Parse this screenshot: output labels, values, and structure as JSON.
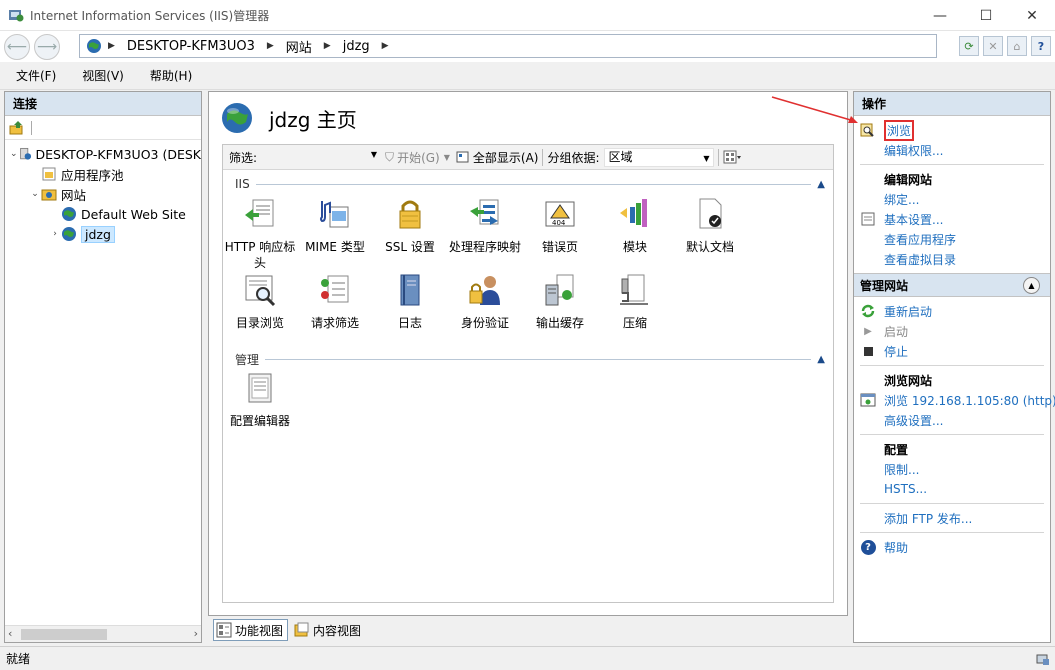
{
  "window": {
    "title": "Internet Information Services (IIS)管理器",
    "minimize_glyph": "—",
    "maximize_glyph": "☐",
    "close_glyph": "✕"
  },
  "address": {
    "segments": [
      "DESKTOP-KFM3UO3",
      "网站",
      "jdzg"
    ]
  },
  "menu": [
    "文件(F)",
    "视图(V)",
    "帮助(H)"
  ],
  "left_panel": {
    "header": "连接",
    "tree": [
      {
        "label": "DESKTOP-KFM3UO3 (DESK",
        "icon": "server-icon"
      },
      {
        "label": "应用程序池",
        "icon": "app-pool-icon"
      },
      {
        "label": "网站",
        "icon": "sites-folder-icon"
      },
      {
        "label": "Default Web Site",
        "icon": "globe-icon"
      },
      {
        "label": "jdzg",
        "icon": "globe-icon"
      }
    ]
  },
  "center": {
    "title": "jdzg 主页",
    "filter": {
      "label": "筛选:",
      "go_label": "开始(G)",
      "show_all_label": "全部显示(A)",
      "group_by_label": "分组依据:",
      "group_by_value": "区域"
    },
    "sections": [
      {
        "name": "IIS",
        "features": [
          {
            "label": "HTTP 响应标头",
            "icon": "http-response-headers-icon"
          },
          {
            "label": "MIME 类型",
            "icon": "mime-types-icon"
          },
          {
            "label": "SSL 设置",
            "icon": "ssl-lock-icon"
          },
          {
            "label": "处理程序映射",
            "icon": "handler-mappings-icon"
          },
          {
            "label": "错误页",
            "icon": "error-pages-icon"
          },
          {
            "label": "模块",
            "icon": "modules-icon"
          },
          {
            "label": "默认文档",
            "icon": "default-document-icon"
          },
          {
            "label": "目录浏览",
            "icon": "directory-browsing-icon"
          },
          {
            "label": "请求筛选",
            "icon": "request-filtering-icon"
          },
          {
            "label": "日志",
            "icon": "logging-icon"
          },
          {
            "label": "身份验证",
            "icon": "authentication-icon"
          },
          {
            "label": "输出缓存",
            "icon": "output-caching-icon"
          },
          {
            "label": "压缩",
            "icon": "compression-icon"
          }
        ]
      },
      {
        "name": "管理",
        "features": [
          {
            "label": "配置编辑器",
            "icon": "configuration-editor-icon"
          }
        ]
      }
    ],
    "tabs": [
      "功能视图",
      "内容视图"
    ]
  },
  "right_panel": {
    "header": "操作",
    "browse": "浏览",
    "edit_permissions": "编辑权限...",
    "edit_site_head": "编辑网站",
    "bindings": "绑定...",
    "basic_settings": "基本设置...",
    "view_apps": "查看应用程序",
    "view_vdirs": "查看虚拟目录",
    "manage_site_head": "管理网站",
    "restart": "重新启动",
    "start": "启动",
    "stop": "停止",
    "browse_site_head": "浏览网站",
    "browse_url": "浏览 192.168.1.105:80 (http)",
    "advanced_settings": "高级设置...",
    "config_head": "配置",
    "limits": "限制...",
    "hsts": "HSTS...",
    "add_ftp": "添加 FTP 发布...",
    "help": "帮助"
  },
  "status": "就绪",
  "colors": {
    "link": "#1f6fbf",
    "header_bg": "#d8e4f0",
    "highlight": "#e03030"
  }
}
